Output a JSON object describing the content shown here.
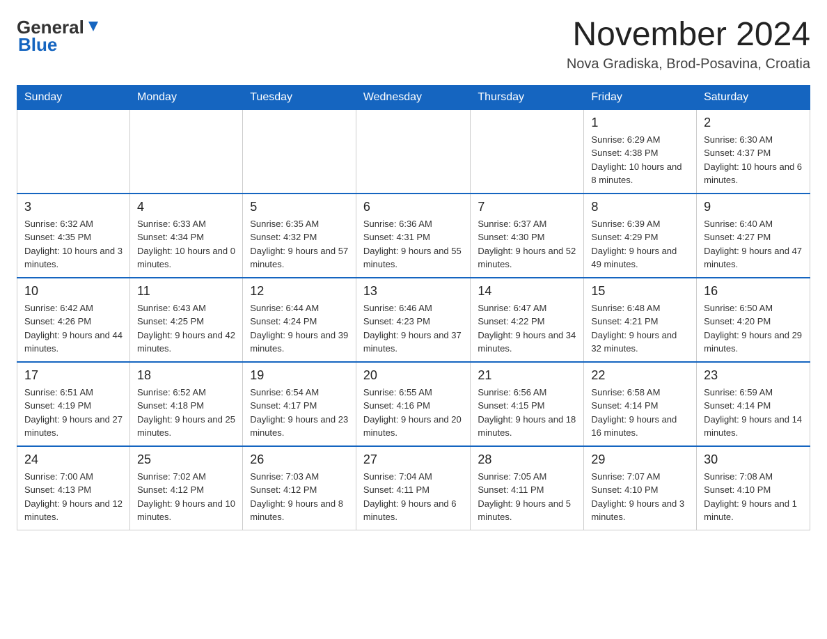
{
  "header": {
    "logo_general": "General",
    "logo_blue": "Blue",
    "month_title": "November 2024",
    "location": "Nova Gradiska, Brod-Posavina, Croatia"
  },
  "calendar": {
    "days_of_week": [
      "Sunday",
      "Monday",
      "Tuesday",
      "Wednesday",
      "Thursday",
      "Friday",
      "Saturday"
    ],
    "weeks": [
      [
        {
          "day": "",
          "info": ""
        },
        {
          "day": "",
          "info": ""
        },
        {
          "day": "",
          "info": ""
        },
        {
          "day": "",
          "info": ""
        },
        {
          "day": "",
          "info": ""
        },
        {
          "day": "1",
          "info": "Sunrise: 6:29 AM\nSunset: 4:38 PM\nDaylight: 10 hours and 8 minutes."
        },
        {
          "day": "2",
          "info": "Sunrise: 6:30 AM\nSunset: 4:37 PM\nDaylight: 10 hours and 6 minutes."
        }
      ],
      [
        {
          "day": "3",
          "info": "Sunrise: 6:32 AM\nSunset: 4:35 PM\nDaylight: 10 hours and 3 minutes."
        },
        {
          "day": "4",
          "info": "Sunrise: 6:33 AM\nSunset: 4:34 PM\nDaylight: 10 hours and 0 minutes."
        },
        {
          "day": "5",
          "info": "Sunrise: 6:35 AM\nSunset: 4:32 PM\nDaylight: 9 hours and 57 minutes."
        },
        {
          "day": "6",
          "info": "Sunrise: 6:36 AM\nSunset: 4:31 PM\nDaylight: 9 hours and 55 minutes."
        },
        {
          "day": "7",
          "info": "Sunrise: 6:37 AM\nSunset: 4:30 PM\nDaylight: 9 hours and 52 minutes."
        },
        {
          "day": "8",
          "info": "Sunrise: 6:39 AM\nSunset: 4:29 PM\nDaylight: 9 hours and 49 minutes."
        },
        {
          "day": "9",
          "info": "Sunrise: 6:40 AM\nSunset: 4:27 PM\nDaylight: 9 hours and 47 minutes."
        }
      ],
      [
        {
          "day": "10",
          "info": "Sunrise: 6:42 AM\nSunset: 4:26 PM\nDaylight: 9 hours and 44 minutes."
        },
        {
          "day": "11",
          "info": "Sunrise: 6:43 AM\nSunset: 4:25 PM\nDaylight: 9 hours and 42 minutes."
        },
        {
          "day": "12",
          "info": "Sunrise: 6:44 AM\nSunset: 4:24 PM\nDaylight: 9 hours and 39 minutes."
        },
        {
          "day": "13",
          "info": "Sunrise: 6:46 AM\nSunset: 4:23 PM\nDaylight: 9 hours and 37 minutes."
        },
        {
          "day": "14",
          "info": "Sunrise: 6:47 AM\nSunset: 4:22 PM\nDaylight: 9 hours and 34 minutes."
        },
        {
          "day": "15",
          "info": "Sunrise: 6:48 AM\nSunset: 4:21 PM\nDaylight: 9 hours and 32 minutes."
        },
        {
          "day": "16",
          "info": "Sunrise: 6:50 AM\nSunset: 4:20 PM\nDaylight: 9 hours and 29 minutes."
        }
      ],
      [
        {
          "day": "17",
          "info": "Sunrise: 6:51 AM\nSunset: 4:19 PM\nDaylight: 9 hours and 27 minutes."
        },
        {
          "day": "18",
          "info": "Sunrise: 6:52 AM\nSunset: 4:18 PM\nDaylight: 9 hours and 25 minutes."
        },
        {
          "day": "19",
          "info": "Sunrise: 6:54 AM\nSunset: 4:17 PM\nDaylight: 9 hours and 23 minutes."
        },
        {
          "day": "20",
          "info": "Sunrise: 6:55 AM\nSunset: 4:16 PM\nDaylight: 9 hours and 20 minutes."
        },
        {
          "day": "21",
          "info": "Sunrise: 6:56 AM\nSunset: 4:15 PM\nDaylight: 9 hours and 18 minutes."
        },
        {
          "day": "22",
          "info": "Sunrise: 6:58 AM\nSunset: 4:14 PM\nDaylight: 9 hours and 16 minutes."
        },
        {
          "day": "23",
          "info": "Sunrise: 6:59 AM\nSunset: 4:14 PM\nDaylight: 9 hours and 14 minutes."
        }
      ],
      [
        {
          "day": "24",
          "info": "Sunrise: 7:00 AM\nSunset: 4:13 PM\nDaylight: 9 hours and 12 minutes."
        },
        {
          "day": "25",
          "info": "Sunrise: 7:02 AM\nSunset: 4:12 PM\nDaylight: 9 hours and 10 minutes."
        },
        {
          "day": "26",
          "info": "Sunrise: 7:03 AM\nSunset: 4:12 PM\nDaylight: 9 hours and 8 minutes."
        },
        {
          "day": "27",
          "info": "Sunrise: 7:04 AM\nSunset: 4:11 PM\nDaylight: 9 hours and 6 minutes."
        },
        {
          "day": "28",
          "info": "Sunrise: 7:05 AM\nSunset: 4:11 PM\nDaylight: 9 hours and 5 minutes."
        },
        {
          "day": "29",
          "info": "Sunrise: 7:07 AM\nSunset: 4:10 PM\nDaylight: 9 hours and 3 minutes."
        },
        {
          "day": "30",
          "info": "Sunrise: 7:08 AM\nSunset: 4:10 PM\nDaylight: 9 hours and 1 minute."
        }
      ]
    ]
  }
}
